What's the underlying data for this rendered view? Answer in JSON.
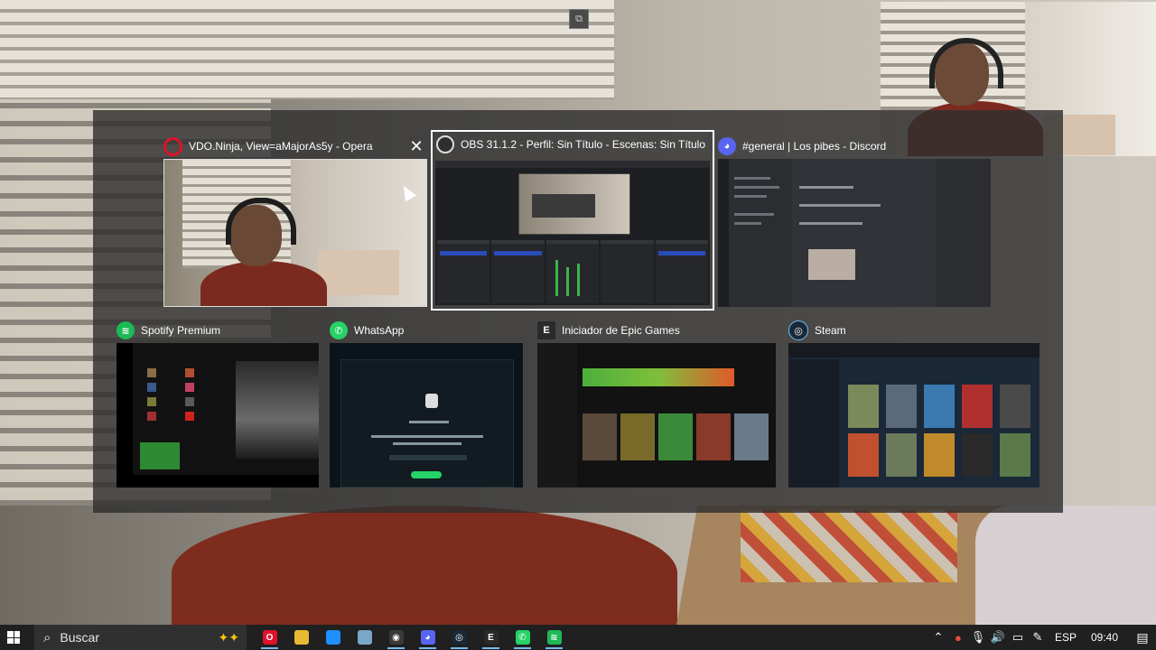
{
  "windows": [
    {
      "title": "VDO.Ninja, View=aMajorAs5y - Opera",
      "icon": "opera-icon",
      "color": "#e0122a",
      "selected": false
    },
    {
      "title": "OBS 31.1.2 - Perfil: Sin Título - Escenas: Sin Título",
      "icon": "obs-icon",
      "color": "#302e31",
      "selected": true
    },
    {
      "title": "#general | Los pibes - Discord",
      "icon": "discord-icon",
      "color": "#5865f2",
      "selected": false
    },
    {
      "title": "Spotify Premium",
      "icon": "spotify-icon",
      "color": "#1db954",
      "selected": false
    },
    {
      "title": "WhatsApp",
      "icon": "whatsapp-icon",
      "color": "#25d366",
      "selected": false
    },
    {
      "title": "Iniciador de Epic Games",
      "icon": "epic-games-icon",
      "color": "#2a2a2a",
      "selected": false
    },
    {
      "title": "Steam",
      "icon": "steam-icon",
      "color": "#1b2838",
      "selected": false
    }
  ],
  "taskbar": {
    "search_placeholder": "Buscar",
    "pinned": [
      {
        "name": "opera-icon",
        "color": "#e0122a",
        "glyph": "O"
      },
      {
        "name": "file-explorer-icon",
        "color": "#e8b931",
        "glyph": ""
      },
      {
        "name": "desktop-app-icon",
        "color": "#1e90ff",
        "glyph": ""
      },
      {
        "name": "photos-icon",
        "color": "#7aa7c7",
        "glyph": ""
      },
      {
        "name": "obs-icon",
        "color": "#3a3a3a",
        "glyph": "◉"
      },
      {
        "name": "discord-icon",
        "color": "#5865f2",
        "glyph": "◕"
      },
      {
        "name": "steam-icon",
        "color": "#1b2838",
        "glyph": "◎"
      },
      {
        "name": "epic-games-icon",
        "color": "#2a2a2a",
        "glyph": "E"
      },
      {
        "name": "whatsapp-icon",
        "color": "#25d366",
        "glyph": "✆"
      },
      {
        "name": "spotify-icon",
        "color": "#1db954",
        "glyph": "≋"
      }
    ],
    "language": "ESP",
    "time": "09:40"
  }
}
